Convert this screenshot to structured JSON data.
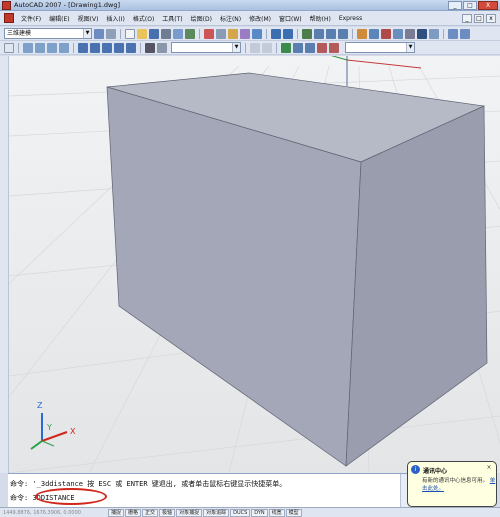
{
  "window": {
    "title": "AutoCAD 2007 - [Drawing1.dwg]",
    "buttons": {
      "minimize": "_",
      "maximize": "□",
      "close": "X"
    }
  },
  "menu": {
    "items": [
      "文件(F)",
      "编辑(E)",
      "视图(V)",
      "插入(I)",
      "格式(O)",
      "工具(T)",
      "绘图(D)",
      "标注(N)",
      "修改(M)",
      "窗口(W)",
      "帮助(H)",
      "Express"
    ],
    "doc_buttons": [
      "_",
      "□",
      "x"
    ]
  },
  "toolbar": {
    "workspace_value": "三维建模"
  },
  "command": {
    "line1": "命令: '_3ddistance 按 ESC 或 ENTER 键退出, 或者单击鼠标右键显示快捷菜单。",
    "line2_prompt": "命令:",
    "line2_value": "3DDISTANCE"
  },
  "status": {
    "coords": "1449.8876, 1676.3906, 0.0000",
    "buttons": [
      "捕捉",
      "栅格",
      "正交",
      "极轴",
      "对象捕捉",
      "对象追踪",
      "DUCS",
      "DYN",
      "线宽",
      "模型"
    ]
  },
  "balloon": {
    "title": "通讯中心",
    "text": "有新的通讯中心信息可用。",
    "link": "单击此处。"
  },
  "ucs": {
    "x": "X",
    "y": "Y",
    "z": "Z"
  },
  "colors": {
    "box_front": "#a3a7b7",
    "box_side": "#999dad",
    "box_top": "#b6b9c6",
    "highlight": "#d0261b"
  }
}
